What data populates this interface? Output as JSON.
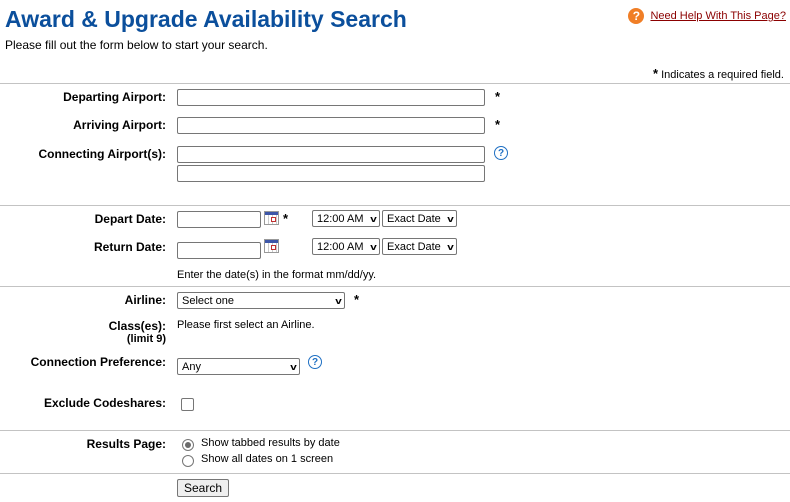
{
  "header": {
    "title": "Award & Upgrade Availability Search",
    "subtitle": "Please fill out the form below to start your search.",
    "help_link": "Need Help With This Page?",
    "help_icon": "question-circle-icon",
    "required_note": "Indicates a required field.",
    "required_marker": "*"
  },
  "airports": {
    "departing_label": "Departing Airport:",
    "departing_value": "",
    "arriving_label": "Arriving Airport:",
    "arriving_value": "",
    "connecting_label": "Connecting Airport(s):",
    "connecting_values": [
      "",
      ""
    ]
  },
  "dates": {
    "depart_label": "Depart Date:",
    "depart_value": "",
    "depart_time": "12:00 AM",
    "depart_flex": "Exact Date",
    "return_label": "Return Date:",
    "return_value": "",
    "return_time": "12:00 AM",
    "return_flex": "Exact Date",
    "format_hint": "Enter the date(s) in the format mm/dd/yy.",
    "calendar_icon": "calendar-icon"
  },
  "options": {
    "airline_label": "Airline:",
    "airline_value": "Select one",
    "classes_label": "Class(es):",
    "classes_limit": "(limit 9)",
    "classes_hint": "Please first select an Airline.",
    "connection_label": "Connection Preference:",
    "connection_value": "Any",
    "exclude_label": "Exclude Codeshares:",
    "exclude_checked": false
  },
  "results": {
    "label": "Results Page:",
    "options": [
      {
        "label": "Show tabbed results by date",
        "checked": true
      },
      {
        "label": "Show all dates on 1 screen",
        "checked": false
      }
    ]
  },
  "search_button": "Search",
  "colors": {
    "title": "#0b4f9c",
    "help_icon": "#f07e26",
    "help_link": "#8b0000",
    "info_icon": "#1e6fc3"
  }
}
